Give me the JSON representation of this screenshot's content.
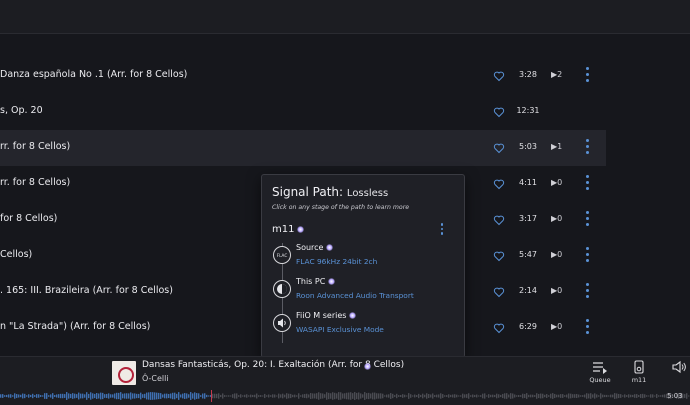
{
  "tracks": [
    {
      "title": "Danza española No .1 (Arr. for 8 Cellos)",
      "duration": "3:28",
      "plays": "▶2"
    },
    {
      "title": "s, Op. 20",
      "duration": "12:31",
      "plays": ""
    },
    {
      "title": "rr. for 8 Cellos)",
      "duration": "5:03",
      "plays": "▶1"
    },
    {
      "title": "rr. for 8 Cellos)",
      "duration": "4:11",
      "plays": "▶0"
    },
    {
      "title": "for 8 Cellos)",
      "duration": "3:17",
      "plays": "▶0"
    },
    {
      "title": "Cellos)",
      "duration": "5:47",
      "plays": "▶0"
    },
    {
      "title": ". 165: III. Brazileira (Arr. for 8 Cellos)",
      "duration": "2:14",
      "plays": "▶0"
    },
    {
      "title": "n \"La Strada\") (Arr. for 8 Cellos)",
      "duration": "6:29",
      "plays": "▶0"
    }
  ],
  "signal_path": {
    "title": "Signal Path:",
    "quality": "Lossless",
    "subtitle": "Click on any stage of the path to learn more",
    "zone": "m11",
    "stages": [
      {
        "name": "Source",
        "detail": "FLAC 96kHz 24bit 2ch",
        "icon": "flac-icon"
      },
      {
        "name": "This PC",
        "detail": "Roon Advanced Audio Transport",
        "icon": "roon-icon"
      },
      {
        "name": "FiiO M series",
        "detail": "WASAPI Exclusive Mode",
        "icon": "speaker-icon"
      }
    ]
  },
  "now_playing": {
    "title": "Dansas Fantasticás, Op. 20: I. Exaltación (Arr. for 8 Cellos)",
    "artist": "Ô-Celli",
    "time": "5:03",
    "queue_label": "Queue",
    "zone_label": "m11"
  },
  "colors": {
    "background": "#16171c",
    "accent": "#5a92d6",
    "popup_bg": "#1f2026",
    "waveform": "#3f6fb0"
  }
}
